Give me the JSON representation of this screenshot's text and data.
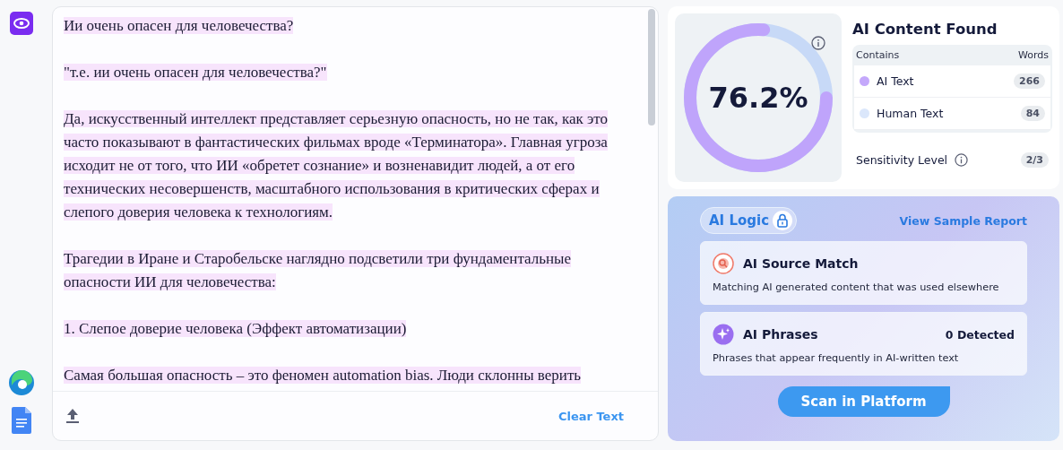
{
  "editor": {
    "paragraphs": [
      {
        "text": "Ии очень опасен для человечества?",
        "highlighted": true
      },
      {
        "text": "\"т.е. ии очень опасен для человечества?\"",
        "highlighted": true
      },
      {
        "text": "Да, искусственный интеллект представляет серьезную опасность, но не так, как это часто показывают в фантастических фильмах вроде «Терминатора». Главная угроза исходит не от того, что ИИ «обретет сознание» и возненавидит людей, а от его технических несовершенств, масштабного использования в критических сферах и слепого доверия человека к технологиям.",
        "highlighted": true
      },
      {
        "text": "Трагедии в Иране и Старобельске наглядно подсветили три фундаментальные опасности ИИ для человечества:",
        "highlighted": true
      },
      {
        "text": "1. Слепое доверие человека (Эффект автоматизации)",
        "highlighted": true
      },
      {
        "text": "Самая большая опасность – это феномен automation bias. Люди склонны верить",
        "highlighted": true
      }
    ],
    "clear_button": "Clear Text"
  },
  "result": {
    "percent": "76.2%",
    "ai_share": {
      "level": 0.762
    },
    "title": "AI Content Found",
    "table": {
      "columns": [
        "Contains",
        "Words"
      ],
      "rows": [
        {
          "label": "AI Text",
          "count": "266",
          "color": "#c4a8fb"
        },
        {
          "label": "Human Text",
          "count": "84",
          "color": "#dbe7fb"
        }
      ]
    },
    "sensitivity": {
      "label": "Sensitivity Level",
      "value": "2/3"
    }
  },
  "logic": {
    "badge": "AI Logic",
    "link": "View Sample Report",
    "cards": [
      {
        "kind": "source",
        "title": "AI Source Match",
        "description": "Matching AI generated content that was used elsewhere"
      },
      {
        "kind": "phrases",
        "title": "AI Phrases",
        "count": "0 Detected",
        "description": "Phrases that appear frequently in AI-written text"
      }
    ],
    "button": "Scan in Platform"
  }
}
